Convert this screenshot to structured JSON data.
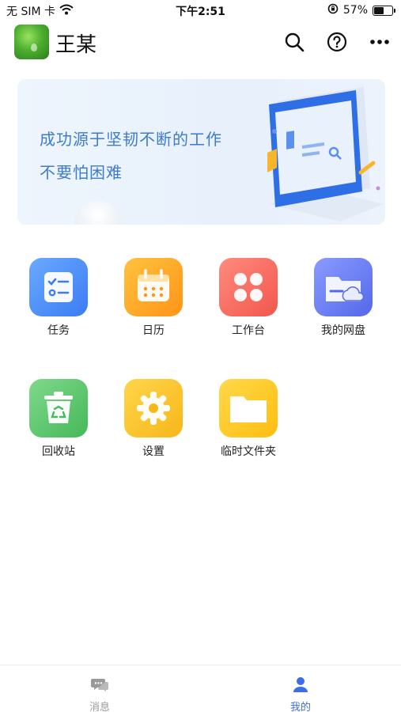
{
  "status_bar": {
    "carrier": "无 SIM 卡",
    "time": "下午2:51",
    "battery_percent": "57%",
    "battery_level": 0.57
  },
  "header": {
    "user_name": "王某",
    "icons": [
      "search-icon",
      "help-icon",
      "more-icon"
    ]
  },
  "banner": {
    "line1": "成功源于坚韧不断的工作",
    "line2": "不要怕困难"
  },
  "apps": [
    {
      "label": "任务",
      "icon": "task-checklist-icon",
      "color": "#3b7cf4"
    },
    {
      "label": "日历",
      "icon": "calendar-icon",
      "color": "#ff9418"
    },
    {
      "label": "工作台",
      "icon": "workbench-clover-icon",
      "color": "#f2574c"
    },
    {
      "label": "我的网盘",
      "icon": "cloud-drive-icon",
      "color": "#5468ea"
    },
    {
      "label": "回收站",
      "icon": "recycle-bin-icon",
      "color": "#45b85a"
    },
    {
      "label": "设置",
      "icon": "settings-gear-icon",
      "color": "#f7b71a"
    },
    {
      "label": "临时文件夹",
      "icon": "folder-icon",
      "color": "#ffbe10"
    }
  ],
  "tabbar": {
    "tabs": [
      {
        "label": "消息",
        "icon": "chat-bubble-icon",
        "active": false
      },
      {
        "label": "我的",
        "icon": "person-icon",
        "active": true
      }
    ],
    "active_color": "#3b6ee6",
    "inactive_color": "#9a9a9a"
  }
}
